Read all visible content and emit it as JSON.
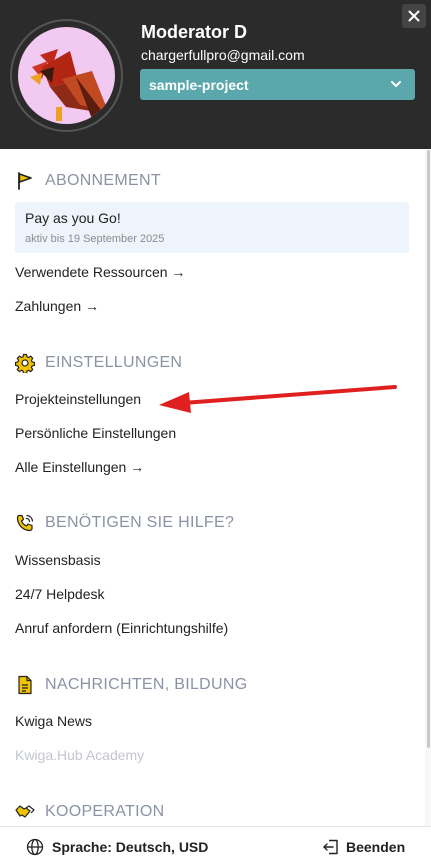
{
  "header": {
    "user_name": "Moderator D",
    "user_email": "chargerfullpro@gmail.com",
    "project": "sample-project",
    "close_label": "×",
    "avatar_icon": "cardinal-bird-icon"
  },
  "sections": {
    "subscription": {
      "title": "ABONNEMENT",
      "icon": "flag-icon",
      "plan_name": "Pay as you Go!",
      "plan_status": "aktiv bis 19 September 2025",
      "links": [
        "Verwendete Ressourcen →",
        "Zahlungen →"
      ]
    },
    "settings": {
      "title": "EINSTELLUNGEN",
      "icon": "gear-icon",
      "links": [
        "Projekteinstellungen",
        "Persönliche Einstellungen",
        "Alle Einstellungen →"
      ]
    },
    "help": {
      "title": "BENÖTIGEN SIE HILFE?",
      "icon": "phone-icon",
      "links": [
        "Wissensbasis",
        "24/7 Helpdesk",
        "Anruf anfordern (Einrichtungshilfe)"
      ]
    },
    "news": {
      "title": "NACHRICHTEN, BILDUNG",
      "icon": "document-icon",
      "links": [
        "Kwiga News",
        "Kwiga.Hub Academy"
      ]
    },
    "cooperation": {
      "title": "KOOPERATION",
      "icon": "handshake-icon"
    }
  },
  "footer": {
    "language": "Sprache: Deutsch, USD",
    "logout": "Beenden"
  },
  "colors": {
    "header_bg": "#2b2b2b",
    "accent": "#5aa8ab",
    "section_title": "#8a93a6",
    "icon_yellow": "#f2c300",
    "annotation_red": "#e02020"
  }
}
